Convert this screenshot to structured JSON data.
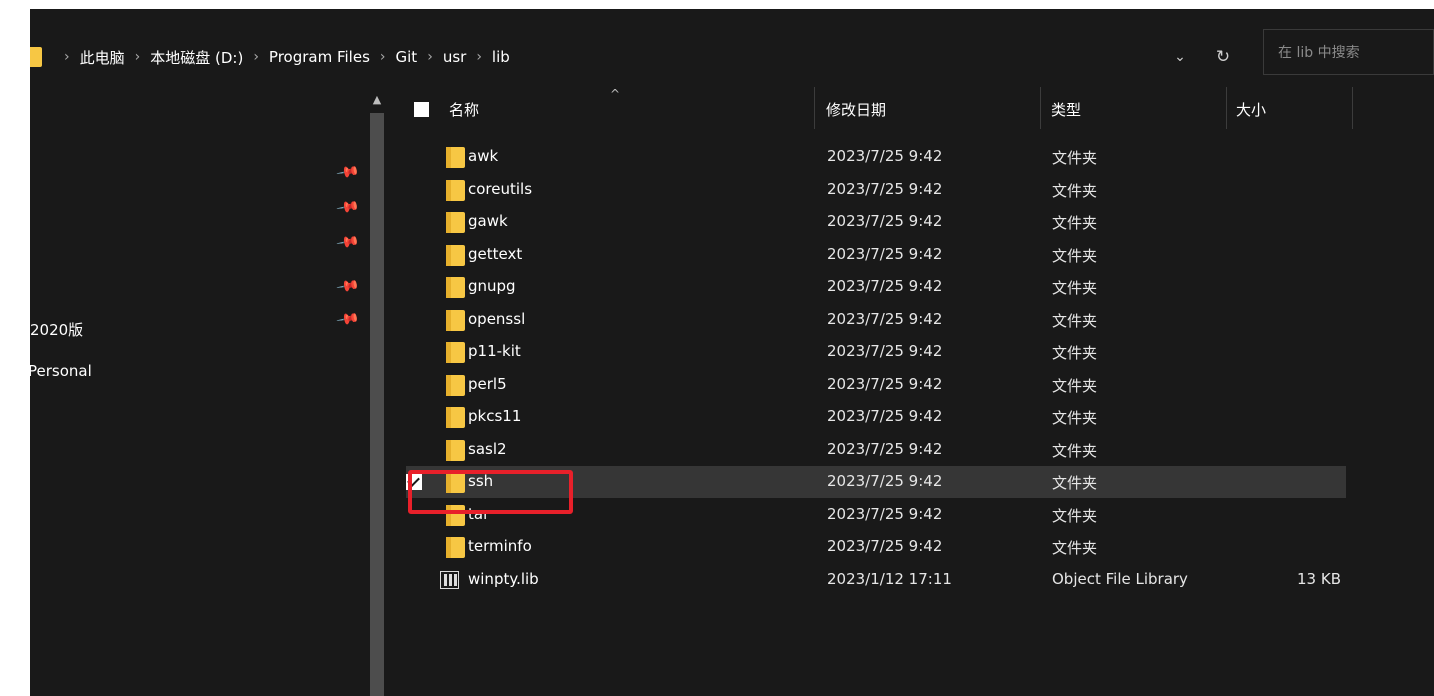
{
  "breadcrumb": [
    "此电脑",
    "本地磁盘 (D:)",
    "Program Files",
    "Git",
    "usr",
    "lib"
  ],
  "address_icons": {
    "dropdown": "chevron-down-icon",
    "refresh": "refresh-icon"
  },
  "search": {
    "placeholder": "在 lib 中搜索"
  },
  "nav": {
    "pins": [
      "pin-icon",
      "pin-icon",
      "pin-icon",
      "pin-icon",
      "pin-icon"
    ],
    "items": [
      "2020版",
      "Personal"
    ]
  },
  "columns": {
    "name": "名称",
    "date": "修改日期",
    "type": "类型",
    "size": "大小"
  },
  "files": [
    {
      "name": "awk",
      "date": "2023/7/25 9:42",
      "type": "文件夹",
      "size": "",
      "icon": "folder-icon"
    },
    {
      "name": "coreutils",
      "date": "2023/7/25 9:42",
      "type": "文件夹",
      "size": "",
      "icon": "folder-icon"
    },
    {
      "name": "gawk",
      "date": "2023/7/25 9:42",
      "type": "文件夹",
      "size": "",
      "icon": "folder-icon"
    },
    {
      "name": "gettext",
      "date": "2023/7/25 9:42",
      "type": "文件夹",
      "size": "",
      "icon": "folder-icon"
    },
    {
      "name": "gnupg",
      "date": "2023/7/25 9:42",
      "type": "文件夹",
      "size": "",
      "icon": "folder-icon"
    },
    {
      "name": "openssl",
      "date": "2023/7/25 9:42",
      "type": "文件夹",
      "size": "",
      "icon": "folder-icon"
    },
    {
      "name": "p11-kit",
      "date": "2023/7/25 9:42",
      "type": "文件夹",
      "size": "",
      "icon": "folder-icon"
    },
    {
      "name": "perl5",
      "date": "2023/7/25 9:42",
      "type": "文件夹",
      "size": "",
      "icon": "folder-icon"
    },
    {
      "name": "pkcs11",
      "date": "2023/7/25 9:42",
      "type": "文件夹",
      "size": "",
      "icon": "folder-icon"
    },
    {
      "name": "sasl2",
      "date": "2023/7/25 9:42",
      "type": "文件夹",
      "size": "",
      "icon": "folder-icon"
    },
    {
      "name": "ssh",
      "date": "2023/7/25 9:42",
      "type": "文件夹",
      "size": "",
      "icon": "folder-icon",
      "selected": true
    },
    {
      "name": "tar",
      "date": "2023/7/25 9:42",
      "type": "文件夹",
      "size": "",
      "icon": "folder-icon"
    },
    {
      "name": "terminfo",
      "date": "2023/7/25 9:42",
      "type": "文件夹",
      "size": "",
      "icon": "folder-icon"
    },
    {
      "name": "winpty.lib",
      "date": "2023/1/12 17:11",
      "type": "Object File Library",
      "size": "13 KB",
      "icon": "library-file-icon"
    }
  ],
  "colors": {
    "background": "#191919",
    "selected_row": "#363636",
    "folder": "#f7c744",
    "annotation": "#e8202a"
  }
}
